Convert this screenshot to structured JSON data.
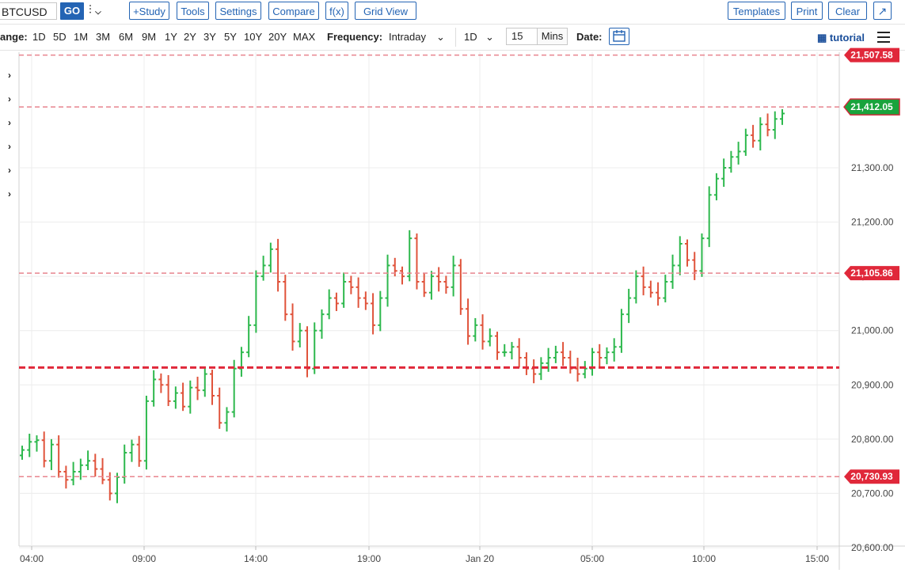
{
  "toolbar": {
    "symbol": "BTCUSD",
    "go_label": "GO",
    "study_label": "+Study",
    "tools_label": "Tools",
    "settings_label": "Settings",
    "compare_label": "Compare",
    "fx_label": "f(x)",
    "gridview_label": "Grid View",
    "templates_label": "Templates",
    "print_label": "Print",
    "clear_label": "Clear"
  },
  "rangebar": {
    "range_label": "ange:",
    "ranges": [
      "1D",
      "5D",
      "1M",
      "3M",
      "6M",
      "9M",
      "1Y",
      "2Y",
      "3Y",
      "5Y",
      "10Y",
      "20Y",
      "MAX"
    ],
    "frequency_label": "Frequency:",
    "frequency_value": "Intraday",
    "period_value": "1D",
    "interval_value": "15",
    "interval_unit": "Mins",
    "date_label": "Date:",
    "tutorial_label": "tutorial"
  },
  "colors": {
    "up": "#2db84d",
    "down": "#e0533b",
    "hline": "#e8848e",
    "hline_strong": "#e0283a",
    "accent": "#2464b4"
  },
  "chart_data": {
    "type": "ohlc",
    "x_ticks": [
      "04:00",
      "09:00",
      "14:00",
      "19:00",
      "Jan 20",
      "05:00",
      "10:00",
      "15:00"
    ],
    "y_ticks": [
      "21,300.00",
      "21,200.00",
      "21,100.00",
      "21,000.00",
      "20,900.00",
      "20,800.00",
      "20,700.00",
      "20,600.00"
    ],
    "y_tick_values": [
      21300,
      21200,
      21100,
      21000,
      20900,
      20800,
      20700,
      20600
    ],
    "ylim": [
      20600,
      21510
    ],
    "price_lines": [
      {
        "value": 21507.58,
        "label": "21,507.58",
        "style": "dashed"
      },
      {
        "value": 21105.86,
        "label": "21,105.86",
        "style": "dashed"
      },
      {
        "value": 20730.93,
        "label": "20,730.93",
        "style": "dashed"
      },
      {
        "value": 20932.0,
        "label": "",
        "style": "bold-dashed"
      }
    ],
    "last_price": {
      "value": 21412.05,
      "label": "21,412.05"
    },
    "bars_close": [
      20780,
      20795,
      20798,
      20760,
      20790,
      20740,
      20725,
      20740,
      20752,
      20760,
      20745,
      20725,
      20700,
      20730,
      20775,
      20790,
      20760,
      20870,
      20910,
      20900,
      20870,
      20885,
      20860,
      20895,
      20890,
      20920,
      20880,
      20830,
      20850,
      20930,
      20960,
      21010,
      21100,
      21120,
      21150,
      21090,
      21030,
      20980,
      21000,
      20930,
      21000,
      21030,
      21060,
      21050,
      21090,
      21080,
      21060,
      21050,
      21010,
      21060,
      21120,
      21110,
      21100,
      21170,
      21090,
      21070,
      21100,
      21090,
      21080,
      21120,
      21040,
      20990,
      21010,
      20980,
      20990,
      20960,
      20960,
      20970,
      20950,
      20930,
      20920,
      20940,
      20950,
      20960,
      20950,
      20930,
      20920,
      20930,
      20960,
      20950,
      20960,
      20970,
      21030,
      21060,
      21100,
      21080,
      21070,
      21060,
      21090,
      21120,
      21160,
      21130,
      21110,
      21170,
      21250,
      21280,
      21300,
      21320,
      21330,
      21360,
      21350,
      21380,
      21370,
      21390,
      21400
    ]
  }
}
